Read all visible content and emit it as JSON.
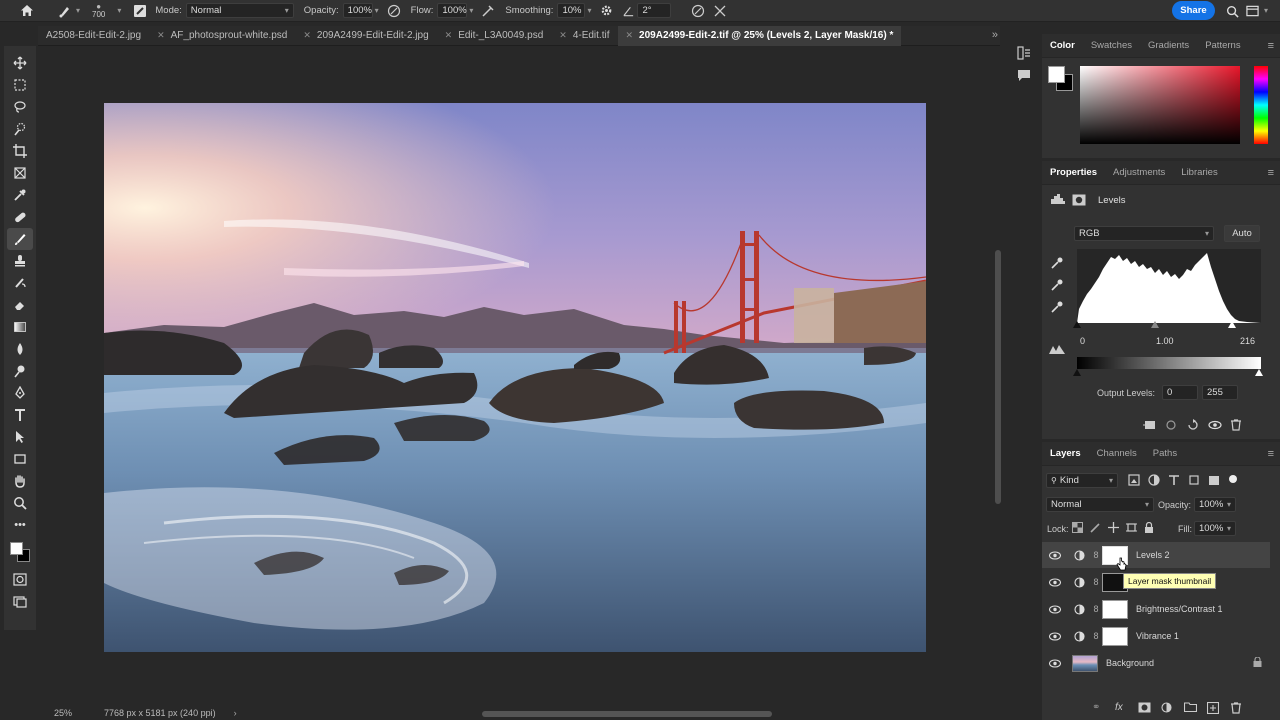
{
  "options_bar": {
    "brush_size": "700",
    "mode_label": "Mode:",
    "mode_value": "Normal",
    "opacity_label": "Opacity:",
    "opacity_value": "100%",
    "flow_label": "Flow:",
    "flow_value": "100%",
    "smoothing_label": "Smoothing:",
    "smoothing_value": "10%",
    "angle_value": "2°",
    "share_label": "Share"
  },
  "tabs": [
    {
      "label": "A2508-Edit-Edit-2.jpg",
      "active": false
    },
    {
      "label": "AF_photosprout-white.psd",
      "active": false
    },
    {
      "label": "209A2499-Edit-Edit-2.jpg",
      "active": false
    },
    {
      "label": "Edit-_L3A0049.psd",
      "active": false
    },
    {
      "label": "4-Edit.tif",
      "active": false
    },
    {
      "label": "209A2499-Edit-2.tif @ 25% (Levels 2, Layer Mask/16) *",
      "active": true
    }
  ],
  "status": {
    "zoom": "25%",
    "doc_size": "7768 px x 5181 px (240 ppi)"
  },
  "color_panel": {
    "tabs": [
      "Color",
      "Swatches",
      "Gradients",
      "Patterns"
    ],
    "active": "Color",
    "foreground": "#ffffff",
    "background": "#000000"
  },
  "properties_panel": {
    "tabs": [
      "Properties",
      "Adjustments",
      "Libraries"
    ],
    "active": "Properties",
    "title": "Levels",
    "channel": "RGB",
    "auto_label": "Auto",
    "input_black": "0",
    "input_mid": "1.00",
    "input_white": "216",
    "output_label": "Output Levels:",
    "output_black": "0",
    "output_white": "255"
  },
  "layers_panel": {
    "tabs": [
      "Layers",
      "Channels",
      "Paths"
    ],
    "active": "Layers",
    "filter_kind": "Kind",
    "blend_mode": "Normal",
    "opacity_label": "Opacity:",
    "opacity_value": "100%",
    "lock_label": "Lock:",
    "fill_label": "Fill:",
    "fill_value": "100%",
    "layers": [
      {
        "name": "Levels 2",
        "selected": true
      },
      {
        "name": "",
        "selected": false
      },
      {
        "name": "Brightness/Contrast 1",
        "selected": false
      },
      {
        "name": "Vibrance 1",
        "selected": false
      },
      {
        "name": "Background",
        "selected": false
      }
    ],
    "tooltip": "Layer mask thumbnail"
  },
  "colors": {
    "accent": "#1473e6",
    "panel": "#323232"
  }
}
